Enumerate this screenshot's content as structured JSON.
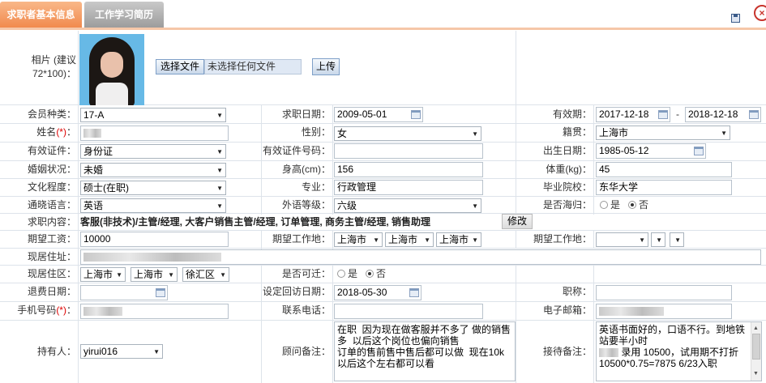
{
  "tabs": [
    {
      "label": "求职者基本信息",
      "active": true
    },
    {
      "label": "工作学习简历",
      "active": false
    }
  ],
  "colors": {
    "tab_active": "#f18a4e",
    "tab_inactive": "#9c9c9c",
    "required": "#dd0000",
    "input_border": "#b8c2cc"
  },
  "icons": {
    "save": "save-icon",
    "close": "close-icon",
    "calendar": "calendar-icon",
    "dropdown": "chevron-down-icon"
  },
  "photo": {
    "label": "相片 (建议72*100)：",
    "choose_file": "选择文件",
    "no_file": "未选择任何文件",
    "upload": "上传"
  },
  "form": {
    "member_type": {
      "label": "会员种类：",
      "value": "17-A"
    },
    "apply_date": {
      "label": "求职日期：",
      "value": "2009-05-01"
    },
    "valid_period": {
      "label": "有效期：",
      "from": "2017-12-18",
      "sep": "-",
      "to": "2018-12-18"
    },
    "name": {
      "label": "姓名",
      "req": "(*)",
      "colon": "："
    },
    "gender": {
      "label": "性别：",
      "value": "女"
    },
    "native_place": {
      "label": "籍贯：",
      "value": "上海市"
    },
    "id_type": {
      "label": "有效证件：",
      "value": "身份证"
    },
    "id_number": {
      "label": "有效证件号码：",
      "value": ""
    },
    "birth_date": {
      "label": "出生日期：",
      "value": "1985-05-12"
    },
    "marital": {
      "label": "婚姻状况：",
      "value": "未婚"
    },
    "height": {
      "label": "身高(cm)：",
      "value": "156"
    },
    "weight": {
      "label": "体重(kg)：",
      "value": "45"
    },
    "education": {
      "label": "文化程度：",
      "value": "硕士(在职)"
    },
    "major": {
      "label": "专业：",
      "value": "行政管理"
    },
    "school": {
      "label": "毕业院校：",
      "value": "东华大学"
    },
    "language": {
      "label": "通晓语言：",
      "value": "英语"
    },
    "lang_level": {
      "label": "外语等级：",
      "value": "六级"
    },
    "overseas": {
      "label": "是否海归：",
      "yes": "是",
      "no": "否",
      "selected": "否"
    },
    "job_content": {
      "label": "求职内容：",
      "value": "客服(非技术)/主管/经理, 大客户销售主管/经理, 订单管理, 商务主管/经理, 销售助理",
      "edit": "修改"
    },
    "expected_salary": {
      "label": "期望工资：",
      "value": "10000"
    },
    "expected_place1": {
      "label": "期望工作地：",
      "values": [
        "上海市",
        "上海市",
        "上海市"
      ]
    },
    "expected_place2": {
      "label": "期望工作地：",
      "values": [
        "",
        "",
        ""
      ]
    },
    "address": {
      "label": "现居住址："
    },
    "district": {
      "label": "现居住区：",
      "values": [
        "上海市",
        "上海市",
        "徐汇区"
      ]
    },
    "relocate": {
      "label": "是否可迁：",
      "yes": "是",
      "no": "否",
      "selected": "否"
    },
    "refund_date": {
      "label": "退费日期：",
      "value": ""
    },
    "revisit_date": {
      "label": "设定回访日期：",
      "value": "2018-05-30"
    },
    "title": {
      "label": "职称：",
      "value": ""
    },
    "mobile": {
      "label": "手机号码",
      "req": "(*)",
      "colon": "："
    },
    "phone": {
      "label": "联系电话：",
      "value": ""
    },
    "email": {
      "label": "电子邮箱：",
      "value": ""
    },
    "owner": {
      "label": "持有人：",
      "value": "yirui016"
    },
    "consultant_note": {
      "label": "顾问备注：",
      "value": "在职  因为现在做客服并不多了 做的销售多  以后这个岗位也偏向销售\n订单的售前售中售后都可以做  现在10k以后这个左右都可以看"
    },
    "reception_note": {
      "label": "接待备注：",
      "line1": "英语书面好的，口语不行。到地铁站要半小时",
      "line2": "录用  10500，试用期不打折",
      "line3": "10500*0.75=7875  6/23入职"
    }
  }
}
